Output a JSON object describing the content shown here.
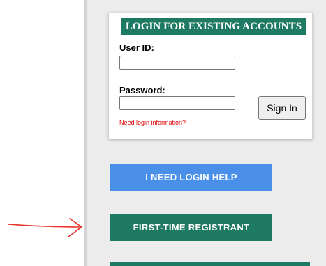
{
  "login": {
    "header": "LOGIN FOR EXISTING ACCOUNTS",
    "user_id_label": "User ID:",
    "user_id_value": "",
    "password_label": "Password:",
    "password_value": "",
    "sign_in_label": "Sign In",
    "need_info_link": "Need login information?"
  },
  "buttons": {
    "login_help": "I NEED LOGIN HELP",
    "first_time": "FIRST-TIME REGISTRANT"
  },
  "colors": {
    "green": "#1f7a63",
    "blue": "#4a90e8",
    "link_red": "#e00000",
    "annotation_red": "#e8322a"
  },
  "annotation": {
    "icon": "hand-drawn-arrow-icon"
  }
}
